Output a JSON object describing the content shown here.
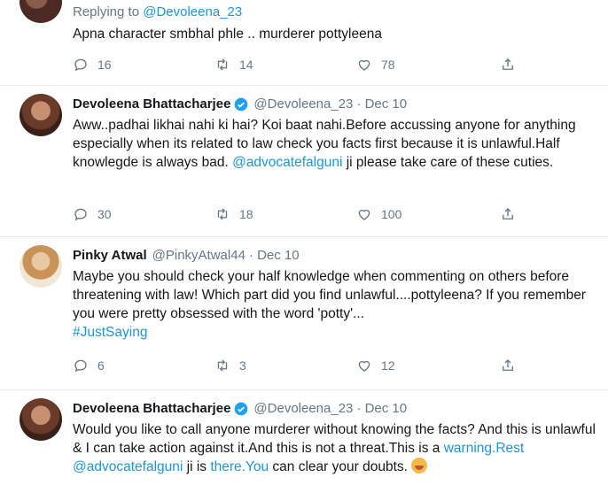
{
  "colors": {
    "accent": "#1b95e0",
    "text": "#14171a",
    "muted": "#657786",
    "verified": "#1da1f2"
  },
  "tweets": [
    {
      "replying_prefix": "Replying to",
      "replying_handle": "@Devoleena_23",
      "text": "Apna character smbhal phle .. murderer pottyleena",
      "replies": "16",
      "retweets": "14",
      "likes": "78"
    },
    {
      "name": "Devoleena Bhattacharjee",
      "verified": true,
      "handle": "@Devoleena_23",
      "date": "· Dec 10",
      "text_before": "Aww..padhai likhai nahi ki hai? Koi baat nahi.Before accussing anyone for anything especially when its related to law check you facts first because it is unlawful.Half knowlegde is always bad. ",
      "mention": "@advocatefalguni",
      "text_after": " ji please take care of these cuties.",
      "replies": "30",
      "retweets": "18",
      "likes": "100"
    },
    {
      "name": "Pinky Atwal",
      "handle": "@PinkyAtwal44",
      "date": "· Dec 10",
      "text": "Maybe you should check your half knowledge when commenting on others before threatening with law! Which part did you find unlawful....pottyleena? If you remember you were pretty obsessed with the word 'potty'...",
      "hashtag": "#JustSaying",
      "replies": "6",
      "retweets": "3",
      "likes": "12"
    },
    {
      "name": "Devoleena Bhattacharjee",
      "verified": true,
      "handle": "@Devoleena_23",
      "date": "· Dec 10",
      "text_before": "Would you like to call anyone murderer without knowing the facts? And this is unlawful & I can take action against it.And this is not a threat.This is a ",
      "link1": "warning.Rest",
      "space": " ",
      "mention": "@advocatefalguni",
      "mid": " ji is ",
      "link2": "there.You",
      "text_after": " can clear your doubts.",
      "emoji": "smiling-face-emoji"
    }
  ]
}
